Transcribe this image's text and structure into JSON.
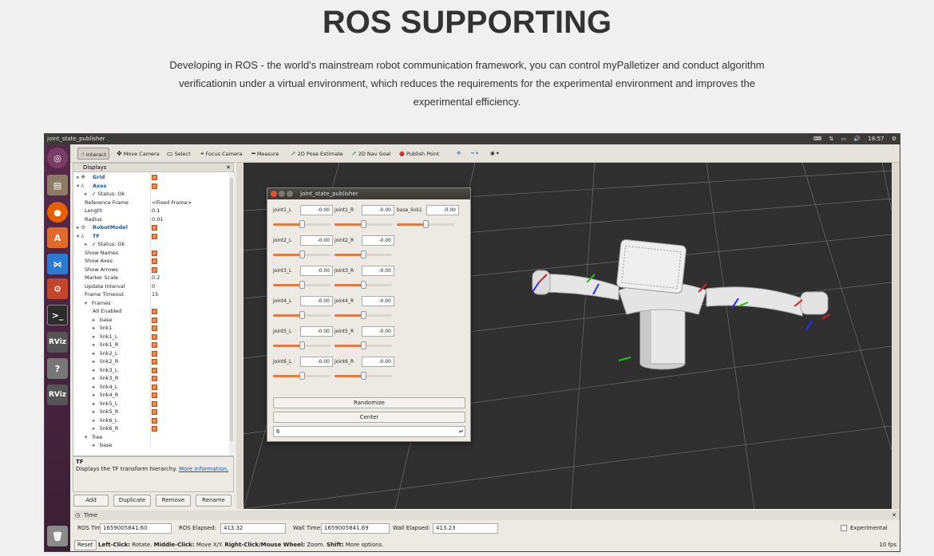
{
  "page": {
    "title": "ROS SUPPORTING",
    "description": "Developing in ROS - the world's mainstream robot communication framework, you can control myPalletizer and conduct algorithm verificationin under a virtual environment, which reduces the requirements for the experimental environment and improves the experimental efficiency."
  },
  "window": {
    "title": "joint_state_publisher",
    "time": "18:57"
  },
  "toolbar": {
    "interact": "Interact",
    "move_camera": "Move Camera",
    "select": "Select",
    "focus_camera": "Focus Camera",
    "measure": "Measure",
    "pose_estimate": "2D Pose Estimate",
    "nav_goal": "2D Nav Goal",
    "publish_point": "Publish Point"
  },
  "launcher": {
    "rviz1": "RViz",
    "rviz2": "RViz"
  },
  "displays": {
    "header": "Displays",
    "rows": [
      {
        "indent": 0,
        "label": "Grid",
        "blue": true,
        "check": true,
        "arrow": "▸",
        "icon": "✥"
      },
      {
        "indent": 0,
        "label": "Axes",
        "blue": true,
        "check": true,
        "arrow": "▾",
        "icon": "⅄"
      },
      {
        "indent": 1,
        "label": "✓ Status: Ok",
        "arrow": "▸"
      },
      {
        "indent": 1,
        "label": "Reference Frame",
        "value": "<Fixed Frame>"
      },
      {
        "indent": 1,
        "label": "Length",
        "value": "0.1"
      },
      {
        "indent": 1,
        "label": "Radius",
        "value": "0.01"
      },
      {
        "indent": 0,
        "label": "RobotModel",
        "blue": true,
        "check": true,
        "arrow": "▸",
        "icon": "⚙"
      },
      {
        "indent": 0,
        "label": "TF",
        "blue": true,
        "check": true,
        "arrow": "▾",
        "icon": "⅄"
      },
      {
        "indent": 1,
        "label": "✓ Status: Ok",
        "arrow": "▸"
      },
      {
        "indent": 1,
        "label": "Show Names",
        "check": true
      },
      {
        "indent": 1,
        "label": "Show Axes",
        "check": true
      },
      {
        "indent": 1,
        "label": "Show Arrows",
        "check": true
      },
      {
        "indent": 1,
        "label": "Marker Scale",
        "value": "0.2"
      },
      {
        "indent": 1,
        "label": "Update Interval",
        "value": "0"
      },
      {
        "indent": 1,
        "label": "Frame Timeout",
        "value": "15"
      },
      {
        "indent": 1,
        "label": "Frames",
        "arrow": "▾"
      },
      {
        "indent": 2,
        "label": "All Enabled",
        "check": true
      },
      {
        "indent": 2,
        "label": "base",
        "check": true,
        "arrow": "▸"
      },
      {
        "indent": 2,
        "label": "link1",
        "check": true,
        "arrow": "▸"
      },
      {
        "indent": 2,
        "label": "link1_L",
        "check": true,
        "arrow": "▸"
      },
      {
        "indent": 2,
        "label": "link1_R",
        "check": true,
        "arrow": "▸"
      },
      {
        "indent": 2,
        "label": "link2_L",
        "check": true,
        "arrow": "▸"
      },
      {
        "indent": 2,
        "label": "link2_R",
        "check": true,
        "arrow": "▸"
      },
      {
        "indent": 2,
        "label": "link3_L",
        "check": true,
        "arrow": "▸"
      },
      {
        "indent": 2,
        "label": "link3_R",
        "check": true,
        "arrow": "▸"
      },
      {
        "indent": 2,
        "label": "link4_L",
        "check": true,
        "arrow": "▸"
      },
      {
        "indent": 2,
        "label": "link4_R",
        "check": true,
        "arrow": "▸"
      },
      {
        "indent": 2,
        "label": "link5_L",
        "check": true,
        "arrow": "▸"
      },
      {
        "indent": 2,
        "label": "link5_R",
        "check": true,
        "arrow": "▸"
      },
      {
        "indent": 2,
        "label": "link6_L",
        "check": true,
        "arrow": "▸"
      },
      {
        "indent": 2,
        "label": "link6_R",
        "check": true,
        "arrow": "▸"
      },
      {
        "indent": 1,
        "label": "Tree",
        "arrow": "▾"
      },
      {
        "indent": 2,
        "label": "base",
        "arrow": "▸"
      }
    ]
  },
  "description_panel": {
    "title": "TF",
    "text": "Displays the TF transform hierarchy.",
    "link": "More Information."
  },
  "buttons": {
    "add": "Add",
    "duplicate": "Duplicate",
    "remove": "Remove",
    "rename": "Rename"
  },
  "jsp": {
    "title": "joint_state_publisher",
    "joints": [
      {
        "name": "joint1_L",
        "value": "-0.00",
        "pos": 0.5
      },
      {
        "name": "joint1_R",
        "value": "-0.00",
        "pos": 0.5
      },
      {
        "name": "base_link1",
        "value": "-0.00",
        "pos": 0.5
      },
      {
        "name": "joint2_L",
        "value": "-0.00",
        "pos": 0.5
      },
      {
        "name": "joint2_R",
        "value": "-0.00",
        "pos": 0.5
      },
      {
        "name": "joint3_L",
        "value": "-0.00",
        "pos": 0.5
      },
      {
        "name": "joint3_R",
        "value": "-0.00",
        "pos": 0.5
      },
      {
        "name": "joint4_L",
        "value": "-0.00",
        "pos": 0.5
      },
      {
        "name": "joint4_R",
        "value": "-0.00",
        "pos": 0.5
      },
      {
        "name": "joint5_L",
        "value": "-0.00",
        "pos": 0.5
      },
      {
        "name": "joint5_R",
        "value": "-0.00",
        "pos": 0.5
      },
      {
        "name": "joint6_L",
        "value": "-0.00",
        "pos": 0.5
      },
      {
        "name": "joint6_R",
        "value": "-0.00",
        "pos": 0.5
      }
    ],
    "randomize": "Randomize",
    "center": "Center",
    "spin_value": "6"
  },
  "time": {
    "header": "Time",
    "ros_time_label": "ROS Time:",
    "ros_time": "1659005841.60",
    "ros_elapsed_label": "ROS Elapsed:",
    "ros_elapsed": "413.32",
    "wall_time_label": "Wall Time:",
    "wall_time": "1659005841.69",
    "wall_elapsed_label": "Wall Elapsed:",
    "wall_elapsed": "413.23",
    "experimental": "Experimental"
  },
  "status": {
    "reset": "Reset",
    "k1": "Left-Click:",
    "t1": " Rotate. ",
    "k2": "Middle-Click:",
    "t2": " Move X/Y. ",
    "k3": "Right-Click/Mouse Wheel:",
    "t3": " Zoom. ",
    "k4": "Shift:",
    "t4": " More options.",
    "fps": "10 fps"
  },
  "colors": {
    "accent": "#e07b45",
    "viewport": "#303030",
    "link": "#1d56a8"
  }
}
